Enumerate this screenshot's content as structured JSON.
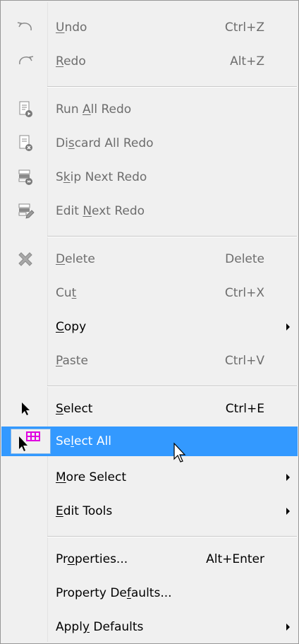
{
  "menu": {
    "undo": {
      "pre": "",
      "u": "U",
      "post": "ndo",
      "shortcut": "Ctrl+Z",
      "icon": "undo-arrow-icon"
    },
    "redo": {
      "pre": "",
      "u": "R",
      "post": "edo",
      "shortcut": "Alt+Z",
      "icon": "redo-arrow-icon"
    },
    "run_all_redo": {
      "pre": "Run ",
      "u": "A",
      "post": "ll Redo",
      "icon": "run-all-redo-icon"
    },
    "discard_all_redo": {
      "pre": "Di",
      "u": "s",
      "post": "card All Redo",
      "icon": "discard-all-redo-icon"
    },
    "skip_next_redo": {
      "pre": "S",
      "u": "k",
      "post": "ip Next Redo",
      "icon": "skip-next-redo-icon"
    },
    "edit_next_redo": {
      "pre": "Edit ",
      "u": "N",
      "post": "ext Redo",
      "icon": "edit-next-redo-icon"
    },
    "delete": {
      "pre": "",
      "u": "D",
      "post": "elete",
      "shortcut": "Delete",
      "icon": "delete-x-icon"
    },
    "cut": {
      "pre": "Cu",
      "u": "t",
      "post": "",
      "shortcut": "Ctrl+X"
    },
    "copy": {
      "pre": "",
      "u": "C",
      "post": "opy"
    },
    "paste": {
      "pre": "",
      "u": "P",
      "post": "aste",
      "shortcut": "Ctrl+V"
    },
    "select": {
      "pre": "",
      "u": "S",
      "post": "elect",
      "shortcut": "Ctrl+E",
      "icon": "arrow-pointer-icon"
    },
    "select_all": {
      "pre": "Se",
      "u": "l",
      "post": "ect All",
      "icon": "select-all-icon"
    },
    "more_select": {
      "pre": "",
      "u": "M",
      "post": "ore Select"
    },
    "edit_tools": {
      "pre": "",
      "u": "E",
      "post": "dit Tools"
    },
    "properties": {
      "pre": "Pr",
      "u": "o",
      "post": "perties...",
      "shortcut": "Alt+Enter"
    },
    "property_defaults": {
      "pre": "Property De",
      "u": "f",
      "post": "aults..."
    },
    "apply_defaults": {
      "pre": "Appl",
      "u": "y",
      "post": " Defaults"
    }
  },
  "colors": {
    "highlight": "#3399ff",
    "disabled_text": "#6d6d6d",
    "background": "#f0f0f0",
    "magenta_icon": "#e000e0"
  }
}
